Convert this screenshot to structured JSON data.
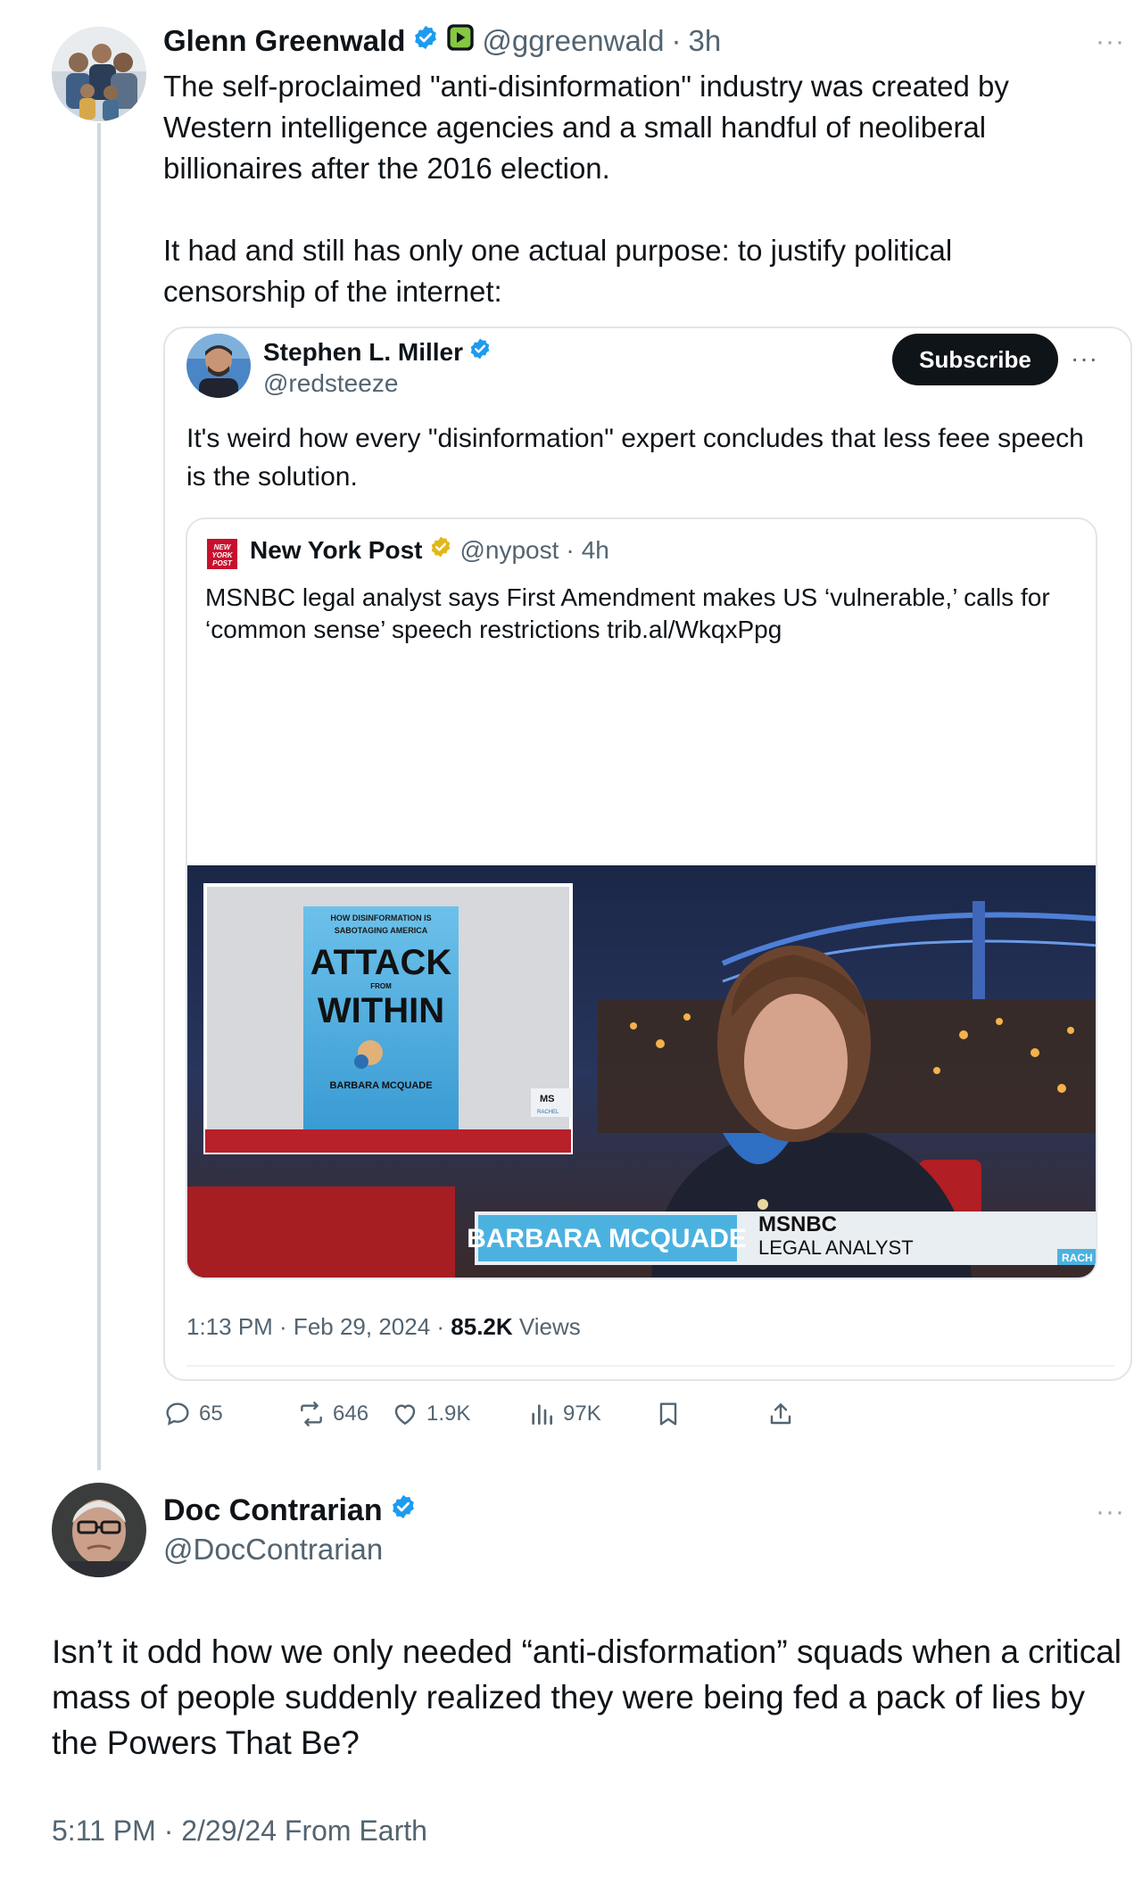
{
  "post1": {
    "author_name": "Glenn Greenwald",
    "handle": "@ggreenwald",
    "separator": "·",
    "time": "3h",
    "text": "The self-proclaimed \"anti-disinformation\" industry was created by Western intelligence agencies and a small handful of neoliberal billionaires after the 2016 election.\n\nIt had and still has only one actual purpose: to justify political censorship of the internet:",
    "more": "···",
    "quote": {
      "author_name": "Stephen L. Miller",
      "handle": "@redsteeze",
      "subscribe_label": "Subscribe",
      "more": "···",
      "text": "It's weird how every \"disinformation\" expert concludes that less feee speech is the solution.",
      "nested": {
        "logo_text": "NEW YORK POST",
        "author_name": "New York Post",
        "handle": "@nypost",
        "separator": "·",
        "time": "4h",
        "text": "MSNBC legal analyst says First Amendment makes US ‘vulnerable,’ calls for ‘common sense’ speech restrictions trib.al/WkqxPpg",
        "media": {
          "book_line1": "HOW DISINFORMATION IS",
          "book_line2": "SABOTAGING AMERICA",
          "book_title1": "ATTACK",
          "book_title_from": "FROM",
          "book_title2": "WITHIN",
          "book_author": "BARBARA MCQUADE",
          "inset_bug": "MS",
          "inset_sub": "RACHEL",
          "chyron_name": "BARBARA MCQUADE",
          "chyron_network": "MSNBC",
          "chyron_title": "LEGAL ANALYST",
          "chyron_corner": "RACH"
        }
      },
      "footer_time": "1:13 PM · Feb 29, 2024 · ",
      "views_count": "85.2K",
      "views_label": " Views"
    },
    "actions": {
      "replies": "65",
      "reposts": "646",
      "likes": "1.9K",
      "views": "97K"
    }
  },
  "post2": {
    "author_name": "Doc Contrarian",
    "handle": "@DocContrarian",
    "more": "···",
    "text": "Isn’t it odd how we only needed “anti-disformation” squads when a critical mass of people suddenly realized they were being fed a pack of lies by the Powers That Be?",
    "timestamp": "5:11 PM · 2/29/24 From Earth"
  },
  "colors": {
    "verified_blue": "#1d9bf0",
    "gold_badge": "#e2b719",
    "text_secondary": "#536471",
    "subscribe_bg": "#0f1419"
  }
}
